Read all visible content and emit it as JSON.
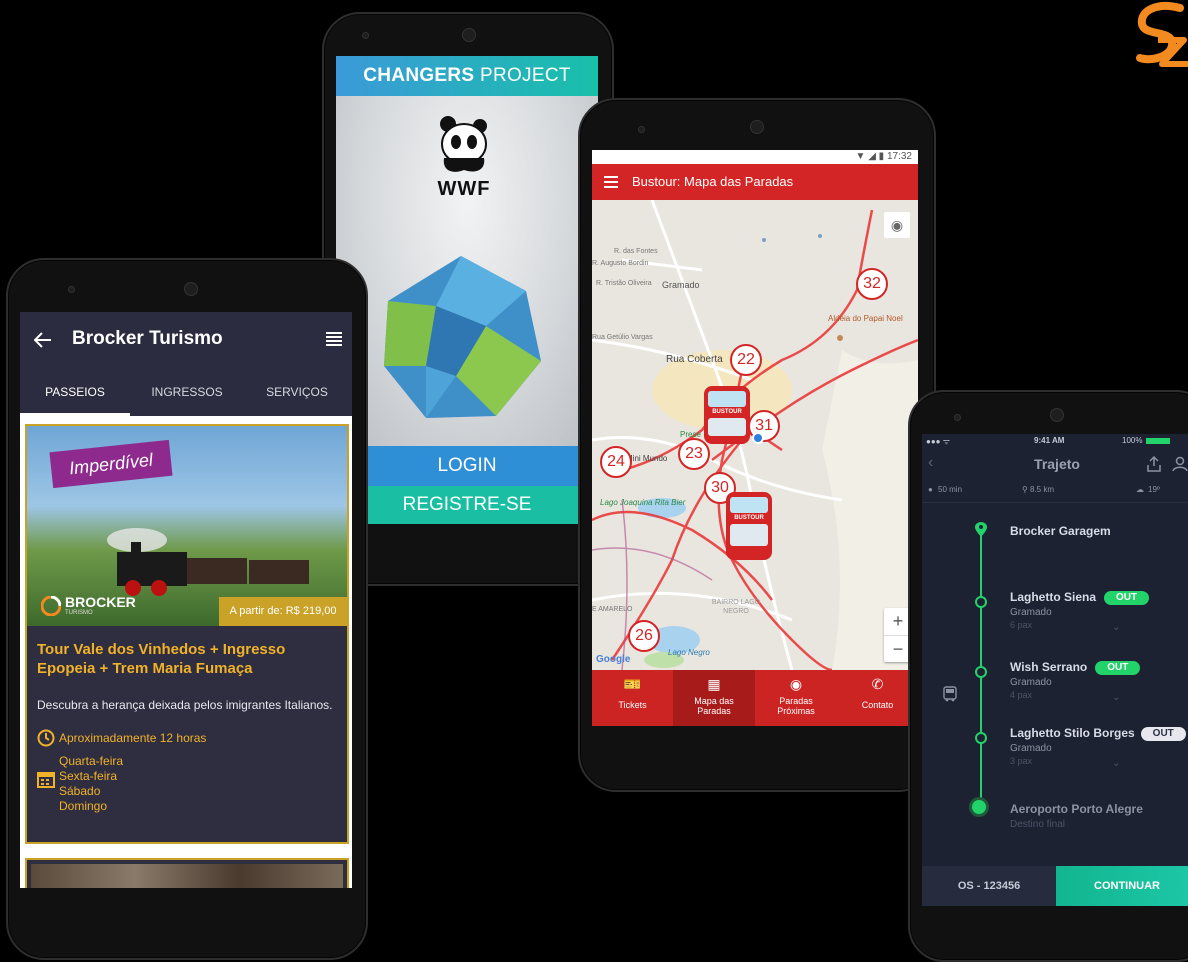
{
  "brand": {
    "logo_icon": "brand-swirl-logo",
    "accent": "#f28a20"
  },
  "wwf_app": {
    "header": {
      "bold": "CHANGERS",
      "rest": " PROJECT"
    },
    "logo_text": "WWF",
    "login_label": "LOGIN",
    "register_label": "REGISTRE-SE",
    "colors": {
      "blue": "#2f8fd6",
      "teal": "#1abfa3"
    }
  },
  "broker_app": {
    "title": "Brocker Turismo",
    "tabs": [
      "PASSEIOS",
      "INGRESSOS",
      "SERVIÇOS"
    ],
    "card": {
      "badge": "Imperdível",
      "company": "BROCKER",
      "company_sub": "TURISMO",
      "price": "A partir de: R$ 219,00",
      "title": "Tour Vale dos Vinhedos + Ingresso Epopeia + Trem Maria Fumaça",
      "description": "Descubra a herança deixada pelos imigrantes Italianos.",
      "duration": "Aproximadamente 12 horas",
      "days": [
        "Quarta-feira",
        "Sexta-feira",
        "Sábado",
        "Domingo"
      ]
    },
    "colors": {
      "primary": "#2c2c40",
      "gold": "#c9a227"
    }
  },
  "map_app": {
    "status_time": "17:32",
    "title": "Bustour: Mapa das Paradas",
    "map_labels": {
      "fontes": "R. das Fontes",
      "augusto": "R. Augusto Bordin",
      "tristao": "R. Tristão Oliveira",
      "gramado": "Gramado",
      "getulio": "Rua Getúlio Vargas",
      "coberta": "Rua Coberta",
      "aldeia": "Aldeia do Papai Noel",
      "mini_mundo": "Mini Mundo",
      "prese": "Prese",
      "lago_joaquina": "Lago Joaquina Rita Bier",
      "bairro": "BAIRRO LAGO NEGRO",
      "lago_negro": "Lago Negro",
      "amarelo": "E AMARELO",
      "google": "Google"
    },
    "stops": [
      "32",
      "22",
      "31",
      "23",
      "24",
      "30",
      "26"
    ],
    "bus_label": "BUSTOUR",
    "zoom_in": "+",
    "zoom_out": "−",
    "nav": [
      "Tickets",
      "Mapa das Paradas",
      "Paradas Próximas",
      "Contato"
    ],
    "colors": {
      "red": "#d32525"
    }
  },
  "route_app": {
    "status_time": "9:41 AM",
    "battery": "100%",
    "title": "Trajeto",
    "stats": {
      "time": "50 min",
      "distance": "8.5 km",
      "temp": "19º"
    },
    "stops": [
      {
        "name": "Brocker Garagem",
        "city": "",
        "pax": "",
        "status": ""
      },
      {
        "name": "Laghetto Siena",
        "city": "Gramado",
        "pax": "6 pax",
        "status": "OUT"
      },
      {
        "name": "Wish Serrano",
        "city": "Gramado",
        "pax": "4 pax",
        "status": "OUT"
      },
      {
        "name": "Laghetto Stilo Borges",
        "city": "Gramado",
        "pax": "3 pax",
        "status": "OUT"
      },
      {
        "name": "Aeroporto Porto Alegre",
        "city": "Destino final",
        "pax": "",
        "status": ""
      }
    ],
    "order_label": "OS - 123456",
    "continue_label": "CONTINUAR",
    "colors": {
      "green": "#22d36a"
    }
  }
}
